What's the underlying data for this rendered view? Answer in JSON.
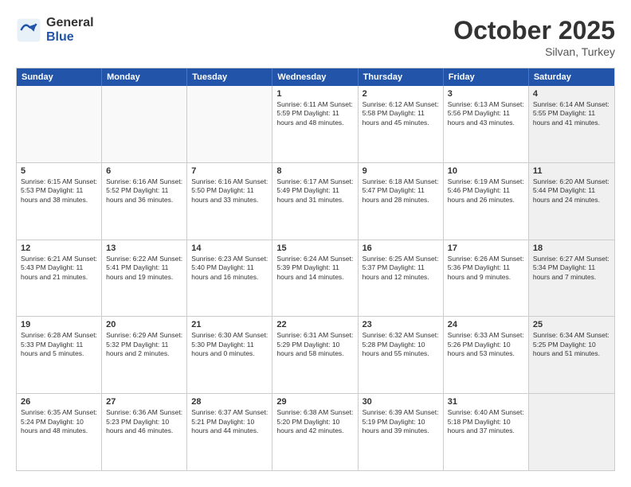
{
  "logo": {
    "general": "General",
    "blue": "Blue"
  },
  "header": {
    "month": "October 2025",
    "location": "Silvan, Turkey"
  },
  "weekdays": [
    "Sunday",
    "Monday",
    "Tuesday",
    "Wednesday",
    "Thursday",
    "Friday",
    "Saturday"
  ],
  "rows": [
    [
      {
        "day": "",
        "text": "",
        "empty": true
      },
      {
        "day": "",
        "text": "",
        "empty": true
      },
      {
        "day": "",
        "text": "",
        "empty": true
      },
      {
        "day": "1",
        "text": "Sunrise: 6:11 AM\nSunset: 5:59 PM\nDaylight: 11 hours and 48 minutes."
      },
      {
        "day": "2",
        "text": "Sunrise: 6:12 AM\nSunset: 5:58 PM\nDaylight: 11 hours and 45 minutes."
      },
      {
        "day": "3",
        "text": "Sunrise: 6:13 AM\nSunset: 5:56 PM\nDaylight: 11 hours and 43 minutes."
      },
      {
        "day": "4",
        "text": "Sunrise: 6:14 AM\nSunset: 5:55 PM\nDaylight: 11 hours and 41 minutes.",
        "shaded": true
      }
    ],
    [
      {
        "day": "5",
        "text": "Sunrise: 6:15 AM\nSunset: 5:53 PM\nDaylight: 11 hours and 38 minutes."
      },
      {
        "day": "6",
        "text": "Sunrise: 6:16 AM\nSunset: 5:52 PM\nDaylight: 11 hours and 36 minutes."
      },
      {
        "day": "7",
        "text": "Sunrise: 6:16 AM\nSunset: 5:50 PM\nDaylight: 11 hours and 33 minutes."
      },
      {
        "day": "8",
        "text": "Sunrise: 6:17 AM\nSunset: 5:49 PM\nDaylight: 11 hours and 31 minutes."
      },
      {
        "day": "9",
        "text": "Sunrise: 6:18 AM\nSunset: 5:47 PM\nDaylight: 11 hours and 28 minutes."
      },
      {
        "day": "10",
        "text": "Sunrise: 6:19 AM\nSunset: 5:46 PM\nDaylight: 11 hours and 26 minutes."
      },
      {
        "day": "11",
        "text": "Sunrise: 6:20 AM\nSunset: 5:44 PM\nDaylight: 11 hours and 24 minutes.",
        "shaded": true
      }
    ],
    [
      {
        "day": "12",
        "text": "Sunrise: 6:21 AM\nSunset: 5:43 PM\nDaylight: 11 hours and 21 minutes."
      },
      {
        "day": "13",
        "text": "Sunrise: 6:22 AM\nSunset: 5:41 PM\nDaylight: 11 hours and 19 minutes."
      },
      {
        "day": "14",
        "text": "Sunrise: 6:23 AM\nSunset: 5:40 PM\nDaylight: 11 hours and 16 minutes."
      },
      {
        "day": "15",
        "text": "Sunrise: 6:24 AM\nSunset: 5:39 PM\nDaylight: 11 hours and 14 minutes."
      },
      {
        "day": "16",
        "text": "Sunrise: 6:25 AM\nSunset: 5:37 PM\nDaylight: 11 hours and 12 minutes."
      },
      {
        "day": "17",
        "text": "Sunrise: 6:26 AM\nSunset: 5:36 PM\nDaylight: 11 hours and 9 minutes."
      },
      {
        "day": "18",
        "text": "Sunrise: 6:27 AM\nSunset: 5:34 PM\nDaylight: 11 hours and 7 minutes.",
        "shaded": true
      }
    ],
    [
      {
        "day": "19",
        "text": "Sunrise: 6:28 AM\nSunset: 5:33 PM\nDaylight: 11 hours and 5 minutes."
      },
      {
        "day": "20",
        "text": "Sunrise: 6:29 AM\nSunset: 5:32 PM\nDaylight: 11 hours and 2 minutes."
      },
      {
        "day": "21",
        "text": "Sunrise: 6:30 AM\nSunset: 5:30 PM\nDaylight: 11 hours and 0 minutes."
      },
      {
        "day": "22",
        "text": "Sunrise: 6:31 AM\nSunset: 5:29 PM\nDaylight: 10 hours and 58 minutes."
      },
      {
        "day": "23",
        "text": "Sunrise: 6:32 AM\nSunset: 5:28 PM\nDaylight: 10 hours and 55 minutes."
      },
      {
        "day": "24",
        "text": "Sunrise: 6:33 AM\nSunset: 5:26 PM\nDaylight: 10 hours and 53 minutes."
      },
      {
        "day": "25",
        "text": "Sunrise: 6:34 AM\nSunset: 5:25 PM\nDaylight: 10 hours and 51 minutes.",
        "shaded": true
      }
    ],
    [
      {
        "day": "26",
        "text": "Sunrise: 6:35 AM\nSunset: 5:24 PM\nDaylight: 10 hours and 48 minutes."
      },
      {
        "day": "27",
        "text": "Sunrise: 6:36 AM\nSunset: 5:23 PM\nDaylight: 10 hours and 46 minutes."
      },
      {
        "day": "28",
        "text": "Sunrise: 6:37 AM\nSunset: 5:21 PM\nDaylight: 10 hours and 44 minutes."
      },
      {
        "day": "29",
        "text": "Sunrise: 6:38 AM\nSunset: 5:20 PM\nDaylight: 10 hours and 42 minutes."
      },
      {
        "day": "30",
        "text": "Sunrise: 6:39 AM\nSunset: 5:19 PM\nDaylight: 10 hours and 39 minutes."
      },
      {
        "day": "31",
        "text": "Sunrise: 6:40 AM\nSunset: 5:18 PM\nDaylight: 10 hours and 37 minutes."
      },
      {
        "day": "",
        "text": "",
        "empty": true,
        "shaded": true
      }
    ]
  ]
}
